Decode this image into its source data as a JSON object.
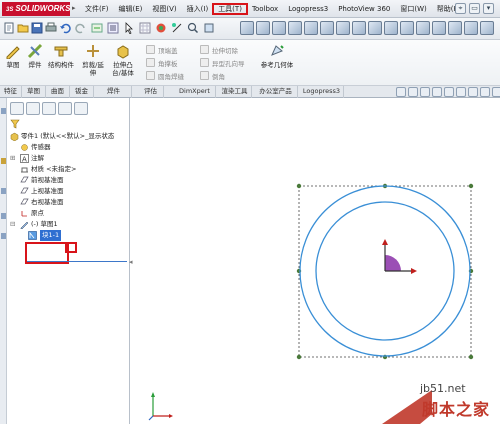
{
  "app": {
    "logo_text": "SOLIDWORKS",
    "logo_prefix": "3S"
  },
  "menu": {
    "items": [
      "文件(F)",
      "编辑(E)",
      "视图(V)",
      "插入(I)",
      "工具(T)",
      "Toolbox",
      "Logopress3",
      "PhotoView 360",
      "窗口(W)",
      "帮助(H)"
    ],
    "highlighted": "工具(T)"
  },
  "commands": {
    "sketch": "草图",
    "weldment": "焊件",
    "structural_member": "结构构件",
    "trim_extend": "剪裁/延伸",
    "extruded_boss": "拉伸凸台/基体",
    "end_cap": "顶端盖",
    "gusset": "角撑板",
    "fillet_bead": "圆角焊缝",
    "extruded_cut": "拉伸切除",
    "hole_wizard": "异型孔向导",
    "chamfer": "倒角",
    "reference_geometry": "参考几何体"
  },
  "tabs": [
    "特征",
    "草图",
    "曲面",
    "钣金",
    "焊件",
    "评估",
    "DimXpert",
    "渲染工具",
    "办公室产品",
    "Logopress3"
  ],
  "active_tab": "焊件",
  "tree": {
    "root": "零件1 (默认<<默认>_显示状态",
    "sensors": "传感器",
    "annotations": "注解",
    "material": "材质 <未指定>",
    "front_plane": "前视基准面",
    "top_plane": "上视基准面",
    "right_plane": "右视基准面",
    "origin": "原点",
    "sketch": "(-) 草图1",
    "block": "块1-1"
  },
  "watermark": {
    "site": "jb51.net",
    "name": "脚本之家"
  },
  "colors": {
    "highlight_red": "#d8141a",
    "circle_blue": "#3a8fd6",
    "selection_blue": "#2f6fd1",
    "axis_purple": "#9b4fb5",
    "axis_red": "#c0201d"
  }
}
